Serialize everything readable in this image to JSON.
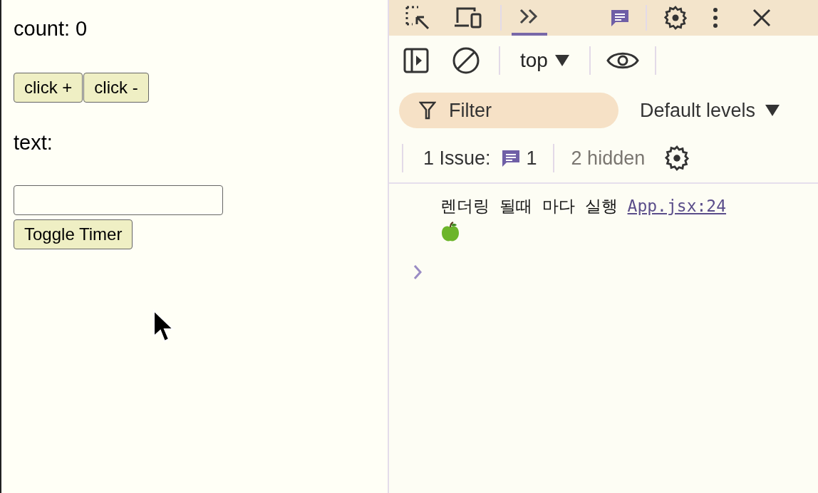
{
  "page": {
    "count_label": "count: 0",
    "buttons": [
      "click +",
      "click -"
    ],
    "text_label": "text:",
    "toggle_button": "Toggle Timer"
  },
  "devtools": {
    "more_tab": {
      "selected": true
    },
    "context": "top",
    "filter": {
      "placeholder": "Filter"
    },
    "levels": "Default levels",
    "issues": {
      "label": "1 Issue:",
      "count": "1"
    },
    "hidden": "2 hidden",
    "log": [
      {
        "message": "렌더링 될때 마다 실행",
        "source": "App.jsx:24"
      }
    ]
  }
}
